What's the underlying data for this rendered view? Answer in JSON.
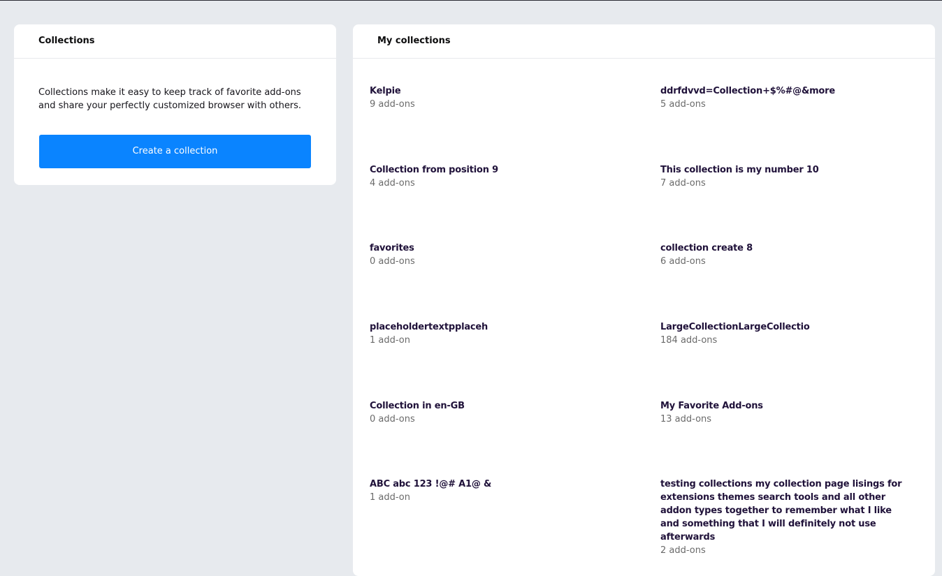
{
  "collections_card": {
    "header": "Collections",
    "intro": "Collections make it easy to keep track of favorite add-ons and share your perfectly customized browser with others.",
    "create_button": "Create a collection"
  },
  "my_collections": {
    "header": "My collections",
    "items": [
      {
        "name": "Kelpie",
        "count": "9 add-ons"
      },
      {
        "name": "ddrfdvvd=Collection+$%#@&more",
        "count": "5 add-ons"
      },
      {
        "name": "Collection from position 9",
        "count": "4 add-ons"
      },
      {
        "name": "This collection is my number 10",
        "count": "7 add-ons"
      },
      {
        "name": "favorites",
        "count": "0 add-ons"
      },
      {
        "name": "collection create 8",
        "count": "6 add-ons"
      },
      {
        "name": "placeholdertextpplaceh",
        "count": "1 add-on"
      },
      {
        "name": "LargeCollectionLargeCollectio",
        "count": "184 add-ons"
      },
      {
        "name": "Collection in en-GB",
        "count": "0 add-ons"
      },
      {
        "name": "My Favorite Add-ons",
        "count": "13 add-ons"
      },
      {
        "name": "ABC abc 123 !@# A1@ &",
        "count": "1 add-on"
      },
      {
        "name": "testing collections my collection page lisings for extensions themes search tools and all other addon types together to remember what I like and something that I will definitely not use afterwards",
        "count": "2 add-ons"
      }
    ]
  },
  "colors": {
    "page_background": "#e7eaee",
    "card_background": "#ffffff",
    "button_blue": "#0a84ff",
    "muted_text": "#6a6a6a"
  }
}
